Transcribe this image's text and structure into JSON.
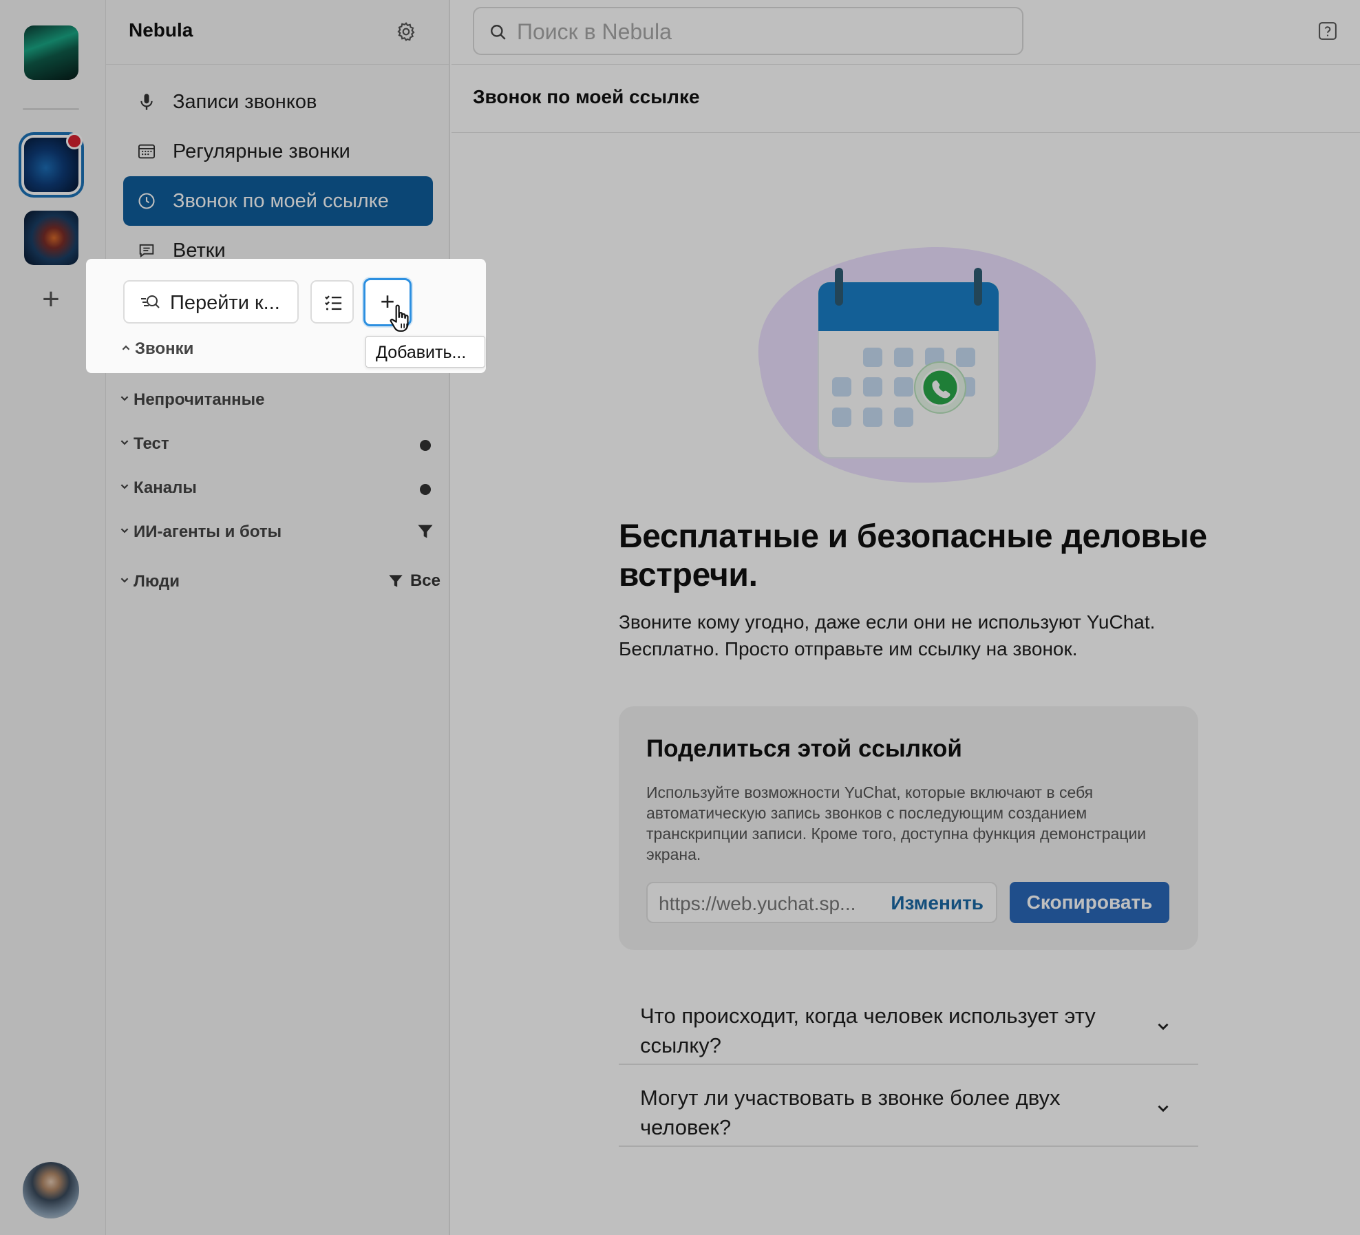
{
  "workspace": {
    "name": "Nebula",
    "colors": {
      "accent": "#0f5e9c",
      "unread_badge": "#d92231",
      "primary_button": "#2a69ba",
      "link": "#1b6aa6"
    }
  },
  "rail": {
    "icons": [
      "aurora-workspace",
      "nebula-workspace",
      "galaxy-workspace",
      "add-icon",
      "user-avatar"
    ]
  },
  "sidebar": {
    "nav": [
      {
        "label": "Записи звонков",
        "icon": "microphone-icon"
      },
      {
        "label": "Регулярные звонки",
        "icon": "calendar-icon"
      },
      {
        "label": "Звонок по моей ссылке",
        "icon": "clock-icon",
        "active": true
      },
      {
        "label": "Ветки",
        "icon": "thread-icon"
      }
    ],
    "sections": [
      {
        "label": "Звонки",
        "expanded": true
      },
      {
        "label": "Непрочитанные"
      },
      {
        "label": "Тест",
        "dot": true
      },
      {
        "label": "Каналы",
        "dot": true
      },
      {
        "label": "ИИ-агенты и боты",
        "filter": true
      },
      {
        "label": "Люди",
        "filter_label": "Все"
      }
    ]
  },
  "popup": {
    "goto_label": "Перейти к...",
    "add_symbol": "+",
    "tooltip": "Добавить..."
  },
  "search": {
    "placeholder": "Поиск в Nebula"
  },
  "main": {
    "page_title": "Звонок по моей ссылке",
    "hero_title": "Бесплатные и безопасные деловые встречи.",
    "hero_subtitle": "Звоните кому угодно, даже если они не используют YuChat. Бесплатно. Просто отправьте им ссылку на звонок.",
    "share": {
      "title": "Поделиться этой ссылкой",
      "description": "Используйте возможности YuChat, которые включают в себя автоматическую запись звонков с последующим созданием транскрипции записи. Кроме того, доступна функция демонстрации экрана.",
      "link": "https://web.yuchat.sp...",
      "change_label": "Изменить",
      "copy_label": "Скопировать"
    },
    "faq": [
      {
        "question": "Что происходит, когда человек использует эту ссылку?"
      },
      {
        "question": "Могут ли участвовать в звонке более двух человек?"
      }
    ]
  }
}
